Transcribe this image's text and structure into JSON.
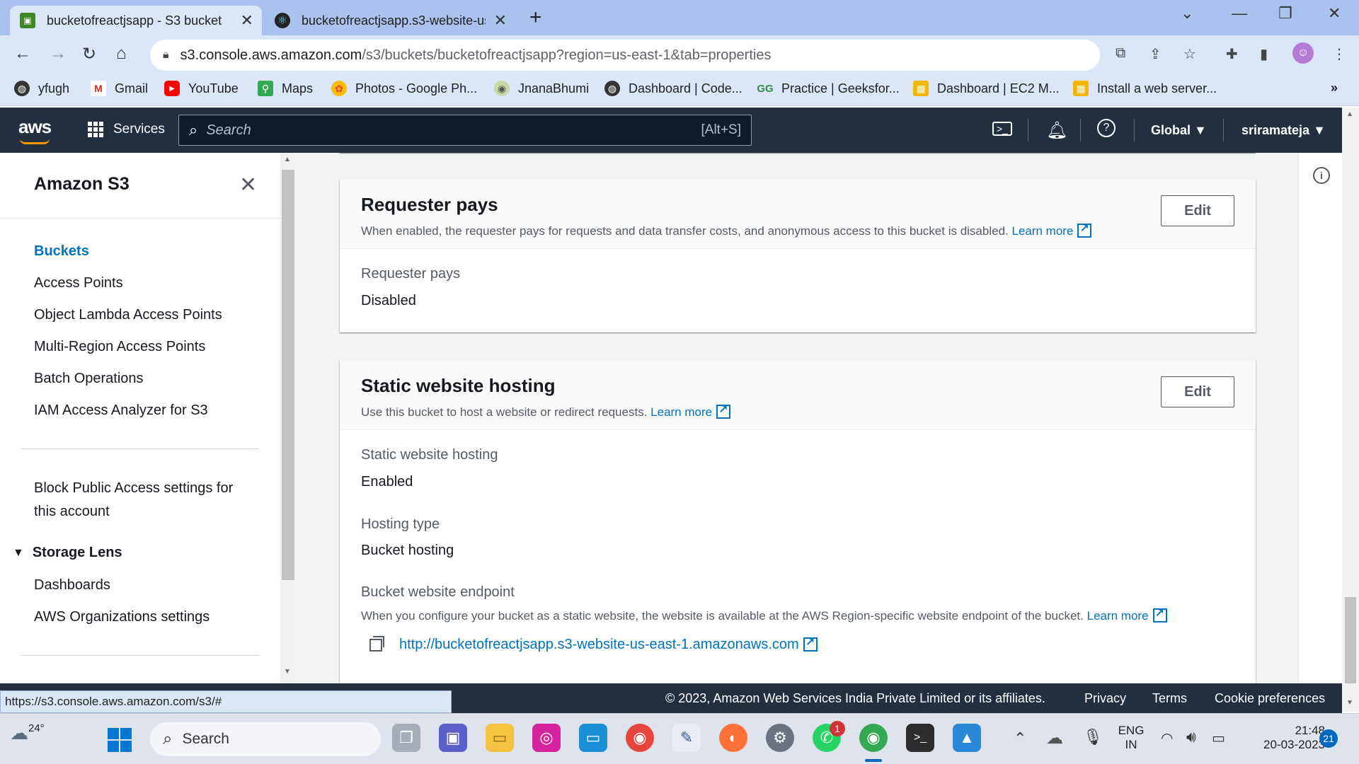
{
  "browser": {
    "tabs": [
      {
        "title": "bucketofreactjsapp - S3 bucket",
        "active": true
      },
      {
        "title": "bucketofreactjsapp.s3-website-us",
        "active": false
      }
    ],
    "url_host": "s3.console.aws.amazon.com",
    "url_path": "/s3/buckets/bucketofreactjsapp?region=us-east-1&tab=properties",
    "bookmarks": [
      {
        "label": "yfugh",
        "icon": "globe-icon"
      },
      {
        "label": "Gmail",
        "icon": "gmail-icon"
      },
      {
        "label": "YouTube",
        "icon": "youtube-icon"
      },
      {
        "label": "Maps",
        "icon": "maps-icon"
      },
      {
        "label": "Photos - Google Ph...",
        "icon": "photos-icon"
      },
      {
        "label": "JnanaBhumi",
        "icon": "jnanabhumi-icon"
      },
      {
        "label": "Dashboard | Code...",
        "icon": "globe-icon"
      },
      {
        "label": "Practice | Geeksfor...",
        "icon": "geeksforgeeks-icon"
      },
      {
        "label": "Dashboard | EC2 M...",
        "icon": "aws-box-icon"
      },
      {
        "label": "Install a web server...",
        "icon": "aws-box-icon"
      }
    ],
    "more_bookmarks": "»",
    "status_url": "https://s3.console.aws.amazon.com/s3/#"
  },
  "aws_header": {
    "logo": "aws",
    "services_label": "Services",
    "search_placeholder": "Search",
    "search_shortcut": "[Alt+S]",
    "region": "Global",
    "user": "sriramateja"
  },
  "sidenav": {
    "title": "Amazon S3",
    "items": [
      {
        "label": "Buckets",
        "active": true
      },
      {
        "label": "Access Points"
      },
      {
        "label": "Object Lambda Access Points"
      },
      {
        "label": "Multi-Region Access Points"
      },
      {
        "label": "Batch Operations"
      },
      {
        "label": "IAM Access Analyzer for S3"
      }
    ],
    "block_public_line1": "Block Public Access settings for",
    "block_public_line2": "this account",
    "storage_lens": "Storage Lens",
    "storage_lens_items": [
      "Dashboards",
      "AWS Organizations settings"
    ]
  },
  "requester_pays": {
    "title": "Requester pays",
    "description": "When enabled, the requester pays for requests and data transfer costs, and anonymous access to this bucket is disabled.",
    "learn_more": "Learn more",
    "edit": "Edit",
    "label": "Requester pays",
    "value": "Disabled"
  },
  "static_hosting": {
    "title": "Static website hosting",
    "description": "Use this bucket to host a website or redirect requests.",
    "learn_more": "Learn more",
    "edit": "Edit",
    "status_label": "Static website hosting",
    "status_value": "Enabled",
    "type_label": "Hosting type",
    "type_value": "Bucket hosting",
    "endpoint_label": "Bucket website endpoint",
    "endpoint_desc": "When you configure your bucket as a static website, the website is available at the AWS Region-specific website endpoint of the bucket.",
    "endpoint_learn_more": "Learn more",
    "endpoint_url": "http://bucketofreactjsapp.s3-website-us-east-1.amazonaws.com"
  },
  "footer": {
    "copyright": "© 2023, Amazon Web Services India Private Limited or its affiliates.",
    "privacy": "Privacy",
    "terms": "Terms",
    "cookies": "Cookie preferences"
  },
  "taskbar": {
    "weather": "24°",
    "search": "Search",
    "whatsapp_badge": "1",
    "lang_line1": "ENG",
    "lang_line2": "IN",
    "time": "21:48",
    "date": "20-03-2023",
    "notifications": "21"
  },
  "colors": {
    "aws_navy": "#232f3e",
    "aws_orange": "#ff9900",
    "link_blue": "#0073bb",
    "chrome_tabstrip": "#a9c3ee",
    "chrome_toolbar": "#dbe6f8"
  }
}
